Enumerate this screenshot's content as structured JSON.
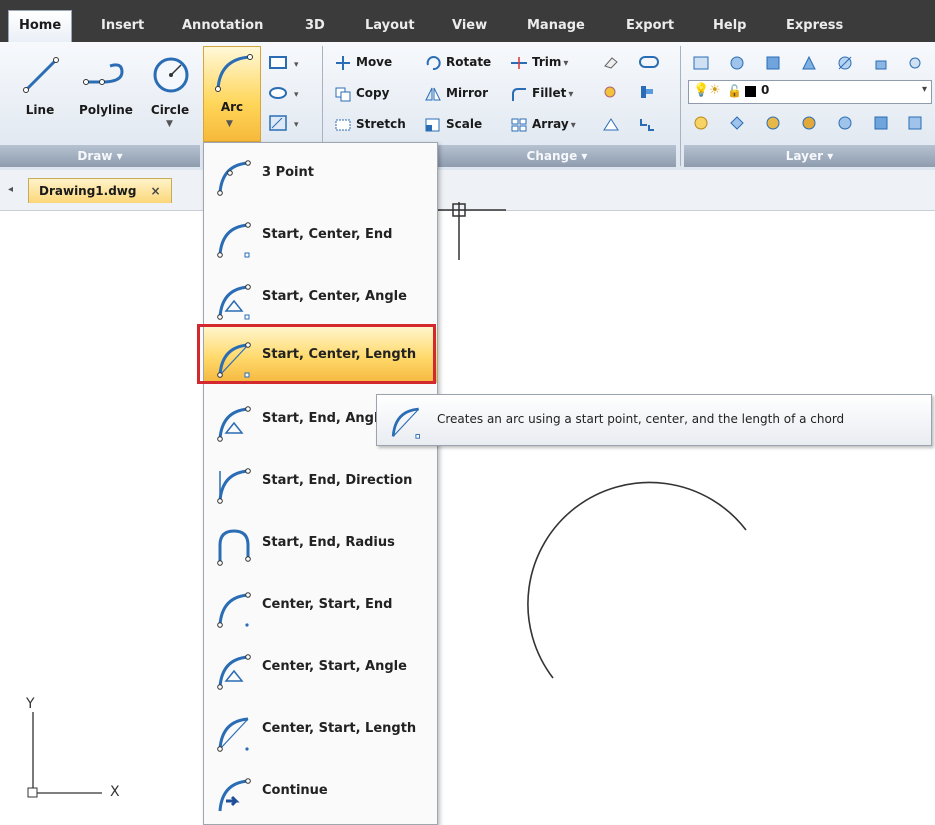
{
  "ribbon_tabs": [
    "Home",
    "Insert",
    "Annotation",
    "3D",
    "Layout",
    "View",
    "Manage",
    "Export",
    "Help",
    "Express"
  ],
  "draw_panel": {
    "line_label": "Line",
    "polyline_label": "Polyline",
    "circle_label": "Circle",
    "arc_label": "Arc",
    "panel_label": "Draw"
  },
  "modify_panel": {
    "move_label": "Move",
    "rotate_label": "Rotate",
    "trim_label": "Trim",
    "copy_label": "Copy",
    "mirror_label": "Mirror",
    "fillet_label": "Fillet",
    "stretch_label": "Stretch",
    "scale_label": "Scale",
    "array_label": "Array",
    "panel_label": "Change"
  },
  "layer_panel": {
    "current_layer": "0",
    "panel_label": "Layer"
  },
  "file_tab": {
    "name": "Drawing1.dwg",
    "close": "×"
  },
  "arc_menu": {
    "items": [
      "3 Point",
      "Start, Center, End",
      "Start, Center, Angle",
      "Start, Center, Length",
      "Start, End, Angle",
      "Start, End, Direction",
      "Start, End, Radius",
      "Center, Start, End",
      "Center, Start, Angle",
      "Center, Start, Length",
      "Continue"
    ],
    "highlighted": "Start, Center, Length"
  },
  "tooltip": {
    "text": "Creates an arc using a start point, center, and the length of a chord"
  },
  "ucs": {
    "x_label": "X",
    "y_label": "Y"
  },
  "colors": {
    "tab_bar": "#3b3b3b",
    "highlight_border": "#d3282e",
    "selected_item": "#ffd96a"
  }
}
